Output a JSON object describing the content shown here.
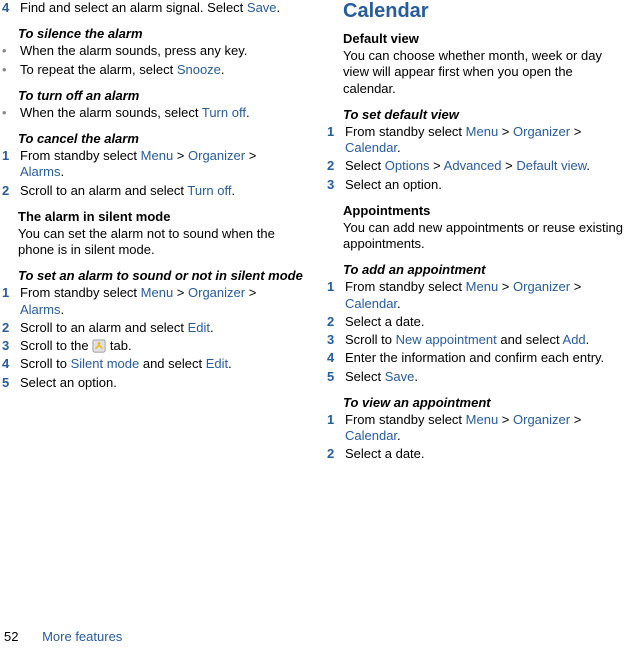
{
  "footer": {
    "page": "52",
    "section": "More features"
  },
  "left": {
    "step4": {
      "n": "4",
      "t1": "Find and select an alarm signal. Select ",
      "save": "Save",
      "t2": "."
    },
    "silence": {
      "heading": "To silence the alarm",
      "b1": "When the alarm sounds, press any key.",
      "b2a": "To repeat the alarm, select ",
      "b2link": "Snooze",
      "b2b": "."
    },
    "turnoffH": "To turn off an alarm",
    "turnoffBody": {
      "a": "When the alarm sounds, select ",
      "link": "Turn off",
      "b": "."
    },
    "cancel": {
      "heading": "To cancel the alarm",
      "s1": {
        "n": "1",
        "a": "From standby select ",
        "menu": "Menu",
        "gt1": " > ",
        "org": "Organizer",
        "gt2": " > ",
        "al": "Alarms",
        "b": "."
      },
      "s2": {
        "n": "2",
        "a": "Scroll to an alarm and select ",
        "link": "Turn off",
        "b": "."
      }
    },
    "silentMode": {
      "heading": "The alarm in silent mode",
      "para": "You can set the alarm not to sound when the phone is in silent mode."
    },
    "setSilent": {
      "heading": "To set an alarm to sound or not in silent mode",
      "s1": {
        "n": "1",
        "a": "From standby select ",
        "menu": "Menu",
        "gt1": " > ",
        "org": "Organizer",
        "gt2": " > ",
        "al": "Alarms",
        "b": "."
      },
      "s2": {
        "n": "2",
        "a": "Scroll to an alarm and select ",
        "link": "Edit",
        "b": "."
      },
      "s3": {
        "n": "3",
        "a": "Scroll to the ",
        "b": " tab."
      },
      "s4": {
        "n": "4",
        "a": "Scroll to ",
        "link": "Silent mode",
        "b": " and select ",
        "link2": "Edit",
        "c": "."
      },
      "s5": {
        "n": "5",
        "a": "Select an option."
      }
    }
  },
  "right": {
    "h1": "Calendar",
    "defView": {
      "heading": "Default view",
      "para": "You can choose whether month, week or day view will appear first when you open the calendar."
    },
    "setDef": {
      "heading": "To set default view",
      "s1": {
        "n": "1",
        "a": "From standby select ",
        "menu": "Menu",
        "gt1": " > ",
        "org": "Organizer",
        "gt2": " > ",
        "cal": "Calendar",
        "b": "."
      },
      "s2": {
        "n": "2",
        "a": "Select ",
        "opt": "Options",
        "gt1": " > ",
        "adv": "Advanced",
        "gt2": " > ",
        "dv": "Default view",
        "b": "."
      },
      "s3": {
        "n": "3",
        "a": "Select an option."
      }
    },
    "appt": {
      "heading": "Appointments",
      "para": "You can add new appointments or reuse existing appointments."
    },
    "addAppt": {
      "heading": "To add an appointment",
      "s1": {
        "n": "1",
        "a": "From standby select ",
        "menu": "Menu",
        "gt1": " > ",
        "org": "Organizer",
        "gt2": " > ",
        "cal": "Calendar",
        "b": "."
      },
      "s2": {
        "n": "2",
        "a": "Select a date."
      },
      "s3": {
        "n": "3",
        "a": "Scroll to ",
        "link": "New appointment",
        "b": " and select ",
        "link2": "Add",
        "c": "."
      },
      "s4": {
        "n": "4",
        "a": "Enter the information and confirm each entry."
      },
      "s5": {
        "n": "5",
        "a": "Select ",
        "link": "Save",
        "b": "."
      }
    },
    "viewAppt": {
      "heading": "To view an appointment",
      "s1": {
        "n": "1",
        "a": "From standby select ",
        "menu": "Menu",
        "gt1": " > ",
        "org": "Organizer",
        "gt2": " > ",
        "cal": "Calendar",
        "b": "."
      },
      "s2": {
        "n": "2",
        "a": "Select a date."
      }
    }
  }
}
